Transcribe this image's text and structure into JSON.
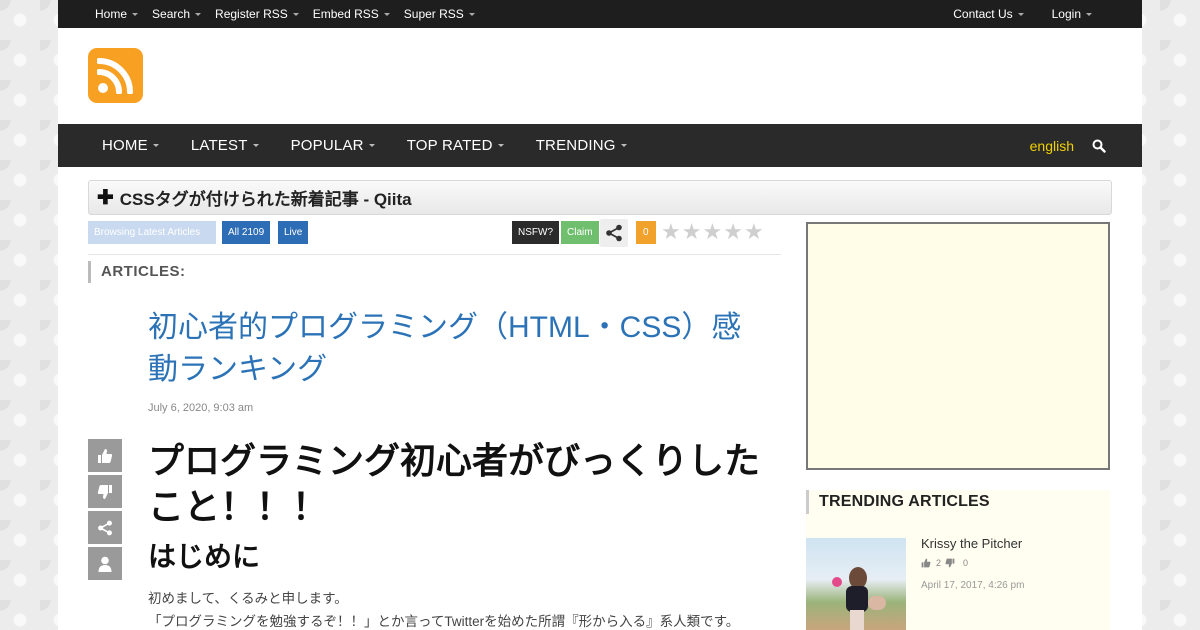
{
  "topnav": {
    "left": [
      "Home",
      "Search",
      "Register RSS",
      "Embed RSS",
      "Super RSS"
    ],
    "right": [
      "Contact Us",
      "Login"
    ]
  },
  "logo": {
    "icon": "rss-icon",
    "color": "#f7a022"
  },
  "mainnav": {
    "items": [
      "HOME",
      "LATEST",
      "POPULAR",
      "TOP RATED",
      "TRENDING"
    ],
    "language": "english",
    "search_icon": "search-icon"
  },
  "feed": {
    "title": "CSSタグが付けられた新着記事 - Qiita"
  },
  "toolbar": {
    "browse": "Browsing Latest Articles",
    "all": "All 2109",
    "live": "Live",
    "nsfw": "NSFW?",
    "claim": "Claim",
    "count": "0",
    "rating_stars": 5,
    "rating_value": 0
  },
  "articles": {
    "label": "ARTICLES:",
    "title": "初心者的プログラミング（HTML・CSS）感動ランキング",
    "date": "July 6, 2020, 9:03 am",
    "heading": "プログラミング初心者がびっくりしたこと！！！",
    "subheading": "はじめに",
    "paragraphs": [
      "初めまして、くるみと申します。",
      "「プログラミングを勉強するぞ！！」とか言ってTwitterを始めた所謂『形から入る』系人類です。"
    ]
  },
  "sidebar": {
    "trending_label": "TRENDING ARTICLES",
    "item": {
      "title": "Krissy the Pitcher",
      "likes": "2",
      "dislikes": "0",
      "date": "April 17, 2017, 4:26 pm"
    }
  }
}
